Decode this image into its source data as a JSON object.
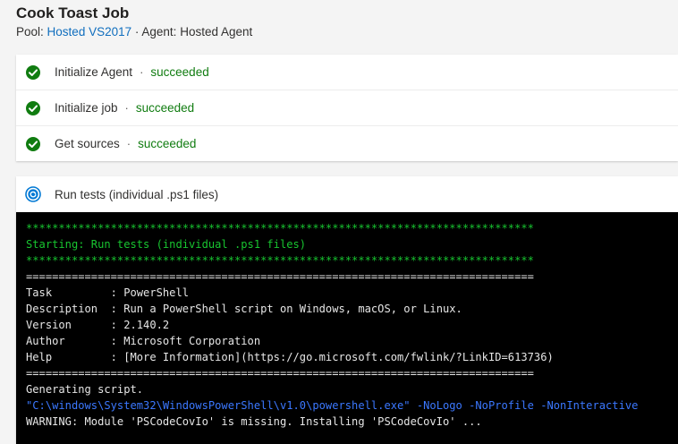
{
  "job": {
    "title": "Cook Toast Job",
    "pool_label": "Pool:",
    "pool_value": "Hosted VS2017",
    "separator": "·",
    "agent_label": "Agent:",
    "agent_value": "Hosted Agent"
  },
  "steps": [
    {
      "name": "Initialize Agent",
      "dot": "·",
      "status": "succeeded",
      "icon": "check-circle-icon"
    },
    {
      "name": "Initialize job",
      "dot": "·",
      "status": "succeeded",
      "icon": "check-circle-icon"
    },
    {
      "name": "Get sources",
      "dot": "·",
      "status": "succeeded",
      "icon": "check-circle-icon"
    }
  ],
  "running_step": {
    "name": "Run tests (individual .ps1 files)",
    "icon": "in-progress-icon"
  },
  "console": {
    "lines": [
      {
        "text": "******************************************************************************",
        "color": "green"
      },
      {
        "text": "Starting: Run tests (individual .ps1 files)",
        "color": "green"
      },
      {
        "text": "******************************************************************************",
        "color": "green"
      },
      {
        "text": "==============================================================================",
        "color": "white"
      },
      {
        "text": "Task         : PowerShell",
        "color": "white"
      },
      {
        "text": "Description  : Run a PowerShell script on Windows, macOS, or Linux.",
        "color": "white"
      },
      {
        "text": "Version      : 2.140.2",
        "color": "white"
      },
      {
        "text": "Author       : Microsoft Corporation",
        "color": "white"
      },
      {
        "text": "Help         : [More Information](https://go.microsoft.com/fwlink/?LinkID=613736)",
        "color": "white"
      },
      {
        "text": "==============================================================================",
        "color": "white"
      },
      {
        "text": "Generating script.",
        "color": "white"
      },
      {
        "text": "\"C:\\windows\\System32\\WindowsPowerShell\\v1.0\\powershell.exe\" -NoLogo -NoProfile -NonInteractive",
        "color": "blue"
      },
      {
        "text": "WARNING: Module 'PSCodeCovIo' is missing. Installing 'PSCodeCovIo' ...",
        "color": "white"
      }
    ]
  },
  "colors": {
    "success": "#107c10",
    "link": "#106ebe",
    "console_bg": "#000000",
    "console_green": "#18c530",
    "console_blue": "#3b78ff",
    "running_blue": "#0078d4"
  }
}
